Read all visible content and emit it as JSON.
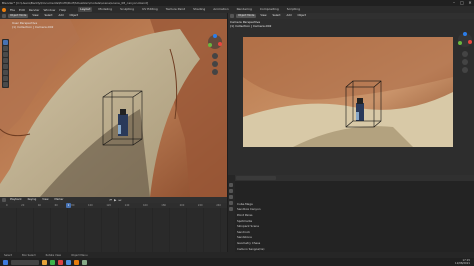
{
  "title": "Blender* [C:\\Users\\Baddy\\Documents\\Profil\\Dolf\\Situation\\models\\scene\\scene_08_canyon.blend]",
  "menu": [
    "File",
    "Edit",
    "Render",
    "Window",
    "Help"
  ],
  "workspace_tabs": [
    "Layout",
    "Modeling",
    "Sculpting",
    "UV Editing",
    "Texture Paint",
    "Shading",
    "Animation",
    "Rendering",
    "Compositing",
    "Scripting"
  ],
  "active_tab": "Layout",
  "left_viewport": {
    "mode": "Object Mode",
    "menus": [
      "View",
      "Select",
      "Add",
      "Object"
    ],
    "info_line1": "User Perspective",
    "info_line2": "(1) Collection | Camera.002"
  },
  "right_viewport": {
    "mode": "Object Mode",
    "menus": [
      "View",
      "Select",
      "Add",
      "Object"
    ],
    "info_line1": "Camera Perspective",
    "info_line2": "(1) Collection | Camera.002"
  },
  "timeline": {
    "menus": [
      "Playback",
      "Keying",
      "View",
      "Marker"
    ],
    "frame_ticks": [
      "0",
      "20",
      "40",
      "60",
      "80",
      "100",
      "120",
      "140",
      "160",
      "180",
      "200",
      "220",
      "240"
    ],
    "current_frame": "1"
  },
  "outliner": {
    "items": [
      "Cube.Mega",
      "Sandbox Canyon",
      "Point Paras",
      "Spotmedia",
      "Skinpack Scene",
      "Sandrock",
      "Sandstone",
      "Geometry Chess",
      "Caduno Sangoa(1s)"
    ]
  },
  "statusbar": {
    "left": "Select",
    "mid": "Box Select",
    "right": "Rotate View",
    "extra": "Object Menu"
  },
  "taskbar_time": "17:15",
  "taskbar_date": "12/08/2021"
}
